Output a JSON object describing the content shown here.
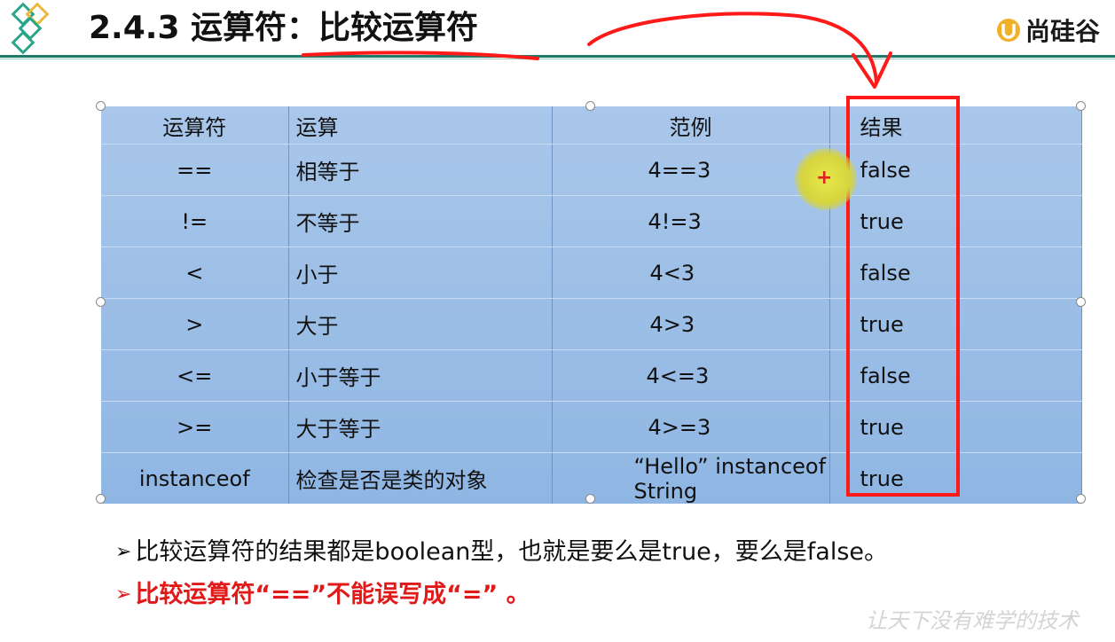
{
  "header": {
    "title": "2.4.3  运算符：比较运算符",
    "brand": "尚硅谷"
  },
  "table": {
    "columns": [
      "运算符",
      "运算",
      "范例",
      "结果"
    ],
    "rows": [
      {
        "op": "==",
        "desc": "相等于",
        "example": "4==3",
        "result": "false"
      },
      {
        "op": "!=",
        "desc": "不等于",
        "example": "4!=3",
        "result": "true"
      },
      {
        "op": "<",
        "desc": "小于",
        "example": "4<3",
        "result": "false"
      },
      {
        "op": ">",
        "desc": "大于",
        "example": "4>3",
        "result": "true"
      },
      {
        "op": "<=",
        "desc": "小于等于",
        "example": "4<=3",
        "result": "false"
      },
      {
        "op": ">=",
        "desc": "大于等于",
        "example": "4>=3",
        "result": "true"
      },
      {
        "op": "instanceof",
        "desc": "检查是否是类的对象",
        "example": "“Hello”  instanceof  String",
        "result": "true"
      }
    ]
  },
  "notes": {
    "line1": "比较运算符的结果都是boolean型，也就是要么是true，要么是false。",
    "line2": "比较运算符“==”不能误写成“=” 。",
    "bullet": "➢"
  },
  "watermark": "让天下没有难学的技术",
  "colors": {
    "annotation_red": "#ff1a1a",
    "title_rule": "#1f7a6a",
    "table_fill": "#a9c7ea",
    "note_red": "#e01919"
  }
}
